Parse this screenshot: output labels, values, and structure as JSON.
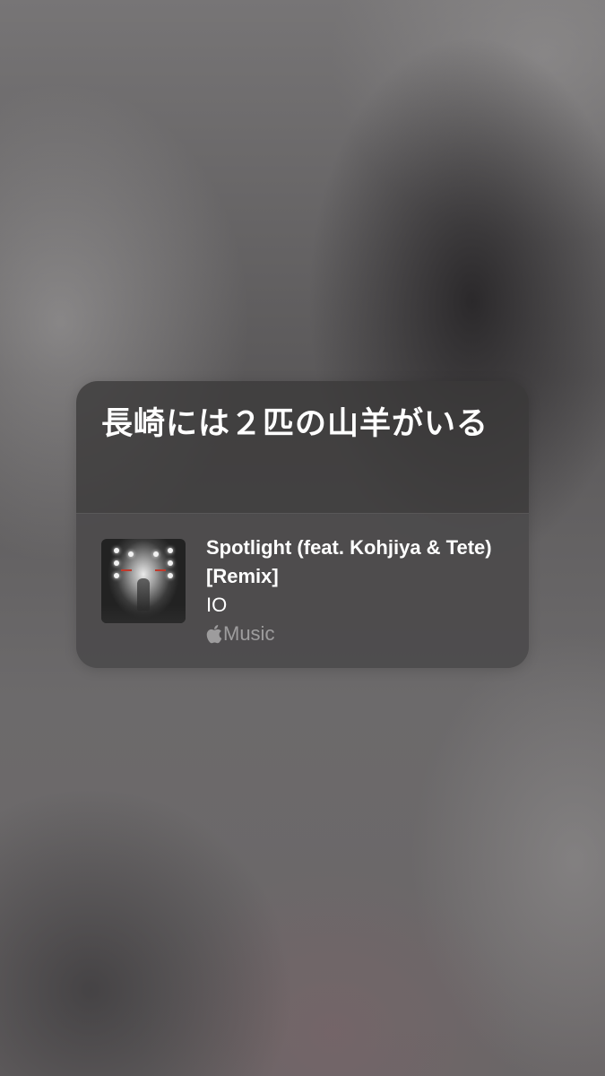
{
  "card": {
    "title": "長崎には２匹の山羊がいる"
  },
  "track": {
    "title": "Spotlight (feat. Kohjiya & Tete) [Remix]",
    "artist": "IO",
    "service_icon": "apple-logo-icon",
    "service_label": "Music"
  },
  "colors": {
    "card_background": "#3a3839",
    "text_primary": "#ffffff",
    "text_secondary": "#9a9899"
  }
}
